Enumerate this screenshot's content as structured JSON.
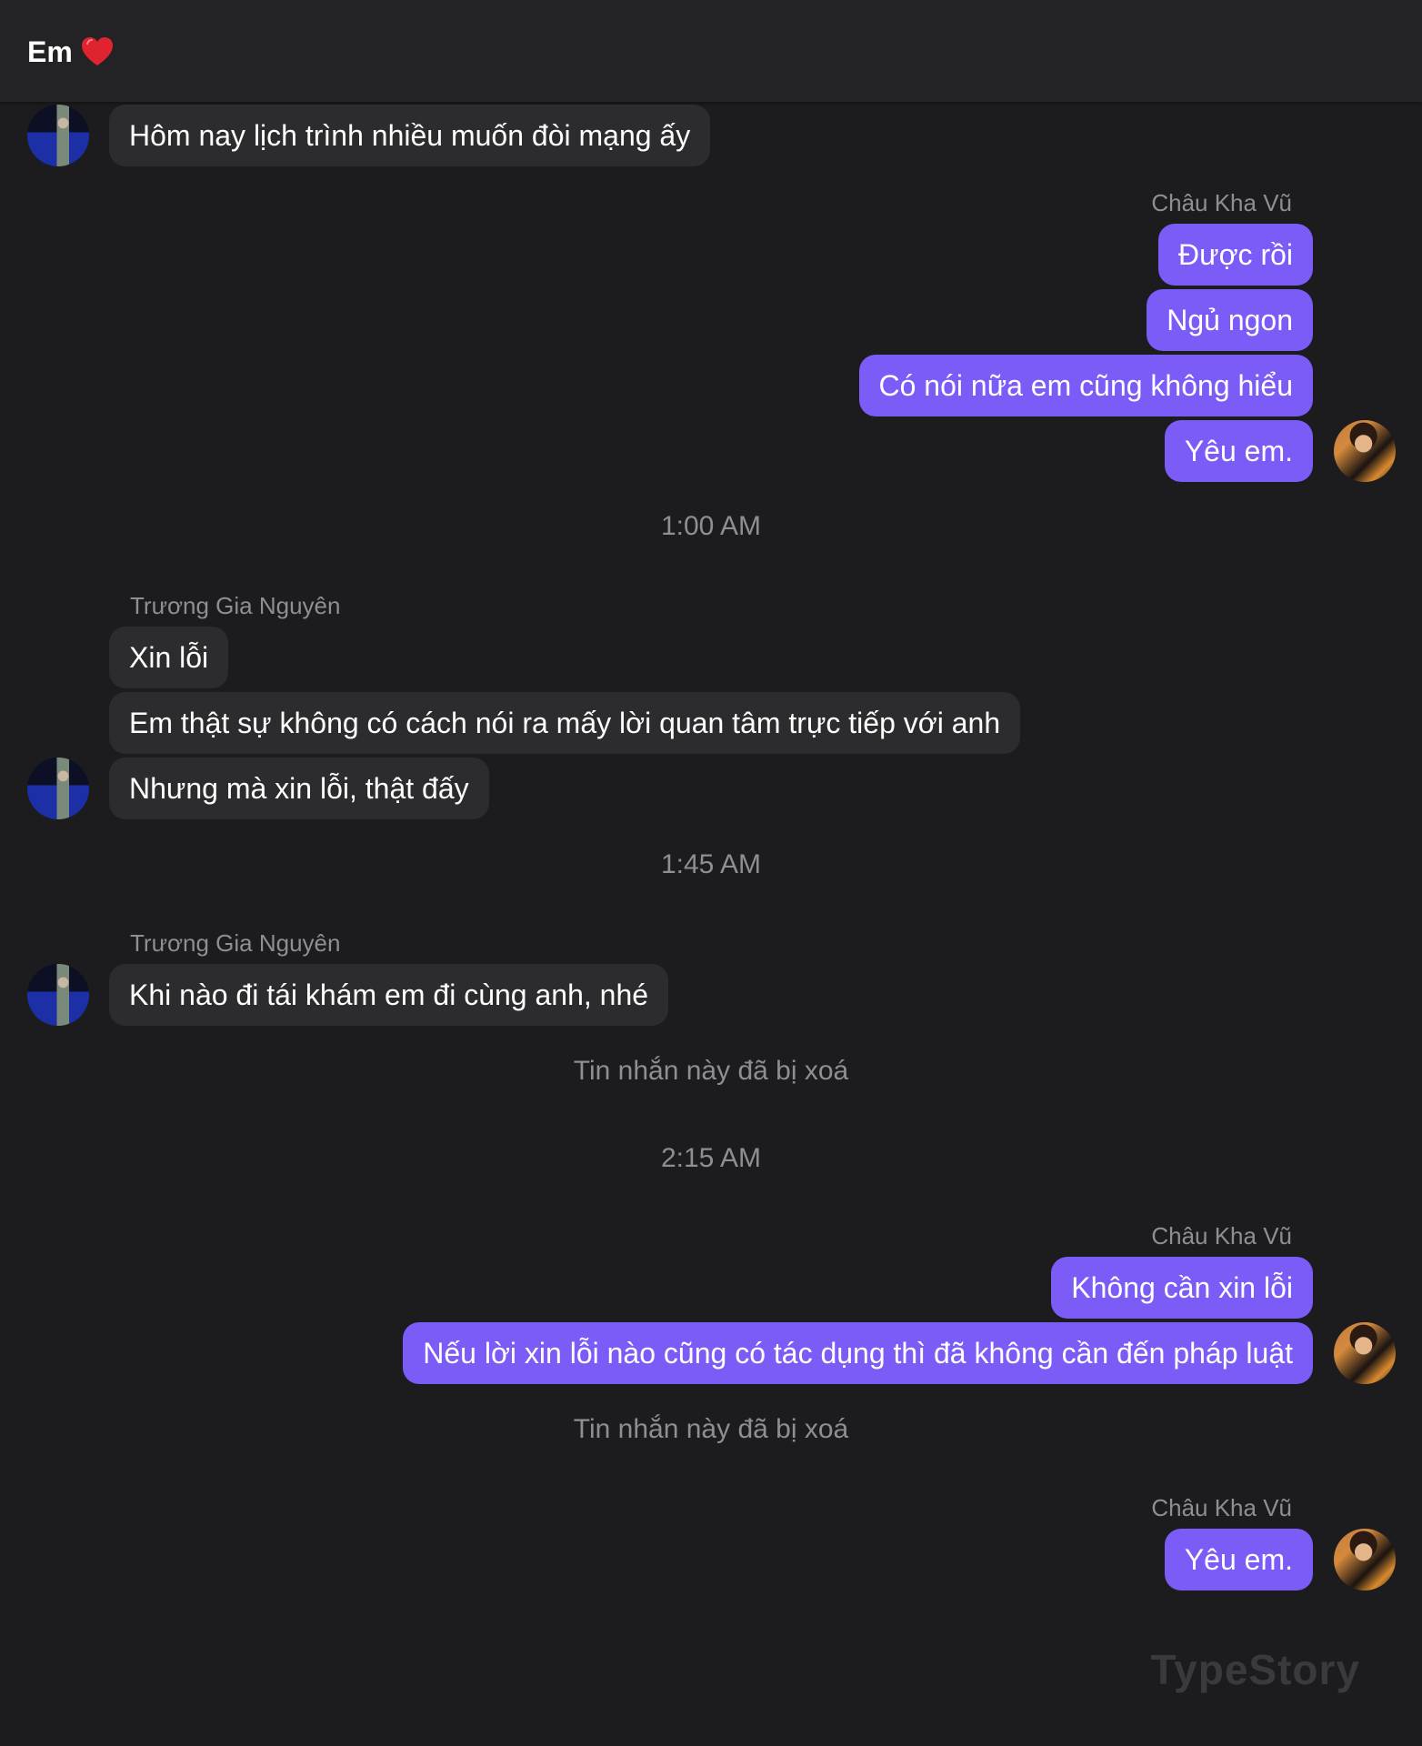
{
  "header": {
    "title": "Em",
    "emoji_icon": "red-heart-icon"
  },
  "colors": {
    "background": "#1c1c1e",
    "header": "#232325",
    "incoming_bubble": "#2c2c2e",
    "outgoing_bubble": "#7b5cf6",
    "meta_text": "#8e8e93"
  },
  "messages": {
    "m1": "Hôm nay lịch trình nhiều muốn đòi mạng ấy",
    "sender_out_1": "Châu Kha Vũ",
    "m2": "Được rồi",
    "m3": "Ngủ ngon",
    "m4": "Có nói nữa em cũng không hiểu",
    "m5": "Yêu em.",
    "time_1": "1:00 AM",
    "sender_in_1": "Trương Gia Nguyên",
    "m6": "Xin lỗi",
    "m7": "Em thật sự không có cách nói ra mấy lời quan tâm trực tiếp với anh",
    "m8": "Nhưng mà xin lỗi, thật đấy",
    "time_2": "1:45 AM",
    "sender_in_2": "Trương Gia Nguyên",
    "m9": "Khi nào đi tái khám em đi cùng anh, nhé",
    "deleted_1": "Tin nhắn này đã bị xoá",
    "time_3": "2:15 AM",
    "sender_out_2": "Châu Kha Vũ",
    "m10": "Không cần xin lỗi",
    "m11": "Nếu lời xin lỗi nào cũng có tác dụng thì đã không cần đến pháp luật",
    "deleted_2": "Tin nhắn này đã bị xoá",
    "sender_out_3": "Châu Kha Vũ",
    "m12": "Yêu em."
  },
  "watermark": "TypeStory"
}
